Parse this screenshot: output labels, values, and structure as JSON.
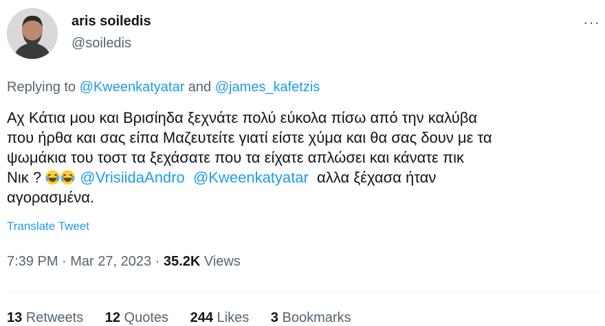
{
  "author": {
    "name": "aris soiledis",
    "handle": "@soiledis"
  },
  "more_icon": "···",
  "replying": {
    "prefix": "Replying to ",
    "user1": "@Kweenkatyatar",
    "joiner": " and ",
    "user2": "@james_kafetzis"
  },
  "tweet": {
    "line1": "Αχ Κάτια μου και Βρισίηδα ξεχνάτε πολύ εύκολα πίσω από την καλύβα",
    "line2": "που ήρθα και σας είπα Μαζευτείτε γιατί είστε χύμα και θα σας δουν με τα",
    "line3": "ψωμάκια του τοστ  τα ξεχάσατε  που τα είχατε απλώσει και κάνατε πικ",
    "line4_start": "Νικ ? ",
    "mention1": "@VrisiidaAndro",
    "mention2": "@Kweenkatyatar",
    "line4_end": "  αλλα ξέχασα ήταν",
    "line5": "αγορασμένα."
  },
  "translate_label": "Translate Tweet",
  "meta": {
    "time": "7:39 PM",
    "sep": " · ",
    "date": "Mar 27, 2023",
    "views_count": "35.2K",
    "views_label": " Views"
  },
  "stats": {
    "retweets_count": "13",
    "retweets_label": " Retweets",
    "quotes_count": "12",
    "quotes_label": " Quotes",
    "likes_count": "244",
    "likes_label": " Likes",
    "bookmarks_count": "3",
    "bookmarks_label": " Bookmarks"
  },
  "colors": {
    "link": "#1d9bf0",
    "secondary": "#536471",
    "text": "#0f1419"
  }
}
